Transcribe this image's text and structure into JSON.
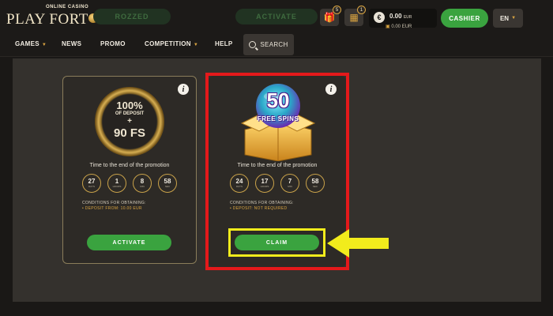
{
  "header": {
    "logo_sub": "ONLINE CASINO",
    "logo_main_1": "PLAY FORT",
    "logo_main_2": "UNA",
    "ghost_btn_1": "ROZZED",
    "ghost_btn_2": "ACTIVATE",
    "gift_count": "5",
    "calendar_count": "1",
    "balance_amount": "0.00",
    "balance_currency": "EUR",
    "bonus_balance": "0.00 EUR",
    "cashier": "CASHIER",
    "lang": "EN"
  },
  "nav": {
    "items": [
      "GAMES",
      "NEWS",
      "PROMO",
      "COMPETITION",
      "HELP"
    ],
    "search": "SEARCH"
  },
  "card1": {
    "badge_line1": "100%",
    "badge_line2": "OF DEPOSIT",
    "badge_line3": "+",
    "badge_line4": "90 FS",
    "time_label": "Time to the end of the promotion",
    "timer": [
      {
        "v": "27",
        "u": "DAYS"
      },
      {
        "v": "1",
        "u": "HOURS"
      },
      {
        "v": "8",
        "u": "MIN"
      },
      {
        "v": "58",
        "u": "SEC"
      }
    ],
    "cond_label": "CONDITIONS FOR OBTAINING:",
    "cond_value": "• DEPOSIT FROM: 10.00 EUR",
    "button": "ACTIVATE"
  },
  "card2": {
    "badge_num": "50",
    "badge_text": "FREE SPINS",
    "time_label": "Time to the end of the promotion",
    "timer": [
      {
        "v": "24",
        "u": "DAYS"
      },
      {
        "v": "17",
        "u": "HOURS"
      },
      {
        "v": "7",
        "u": "MIN"
      },
      {
        "v": "58",
        "u": "SEC"
      }
    ],
    "cond_label": "CONDITIONS FOR OBTAINING:",
    "cond_value": "• DEPOSIT: NOT REQUIRED",
    "button": "CLAIM"
  },
  "colors": {
    "accent_green": "#3aa33f",
    "gold": "#d9a441",
    "highlight_red": "#e4191b",
    "highlight_yellow": "#f2ec1c"
  }
}
